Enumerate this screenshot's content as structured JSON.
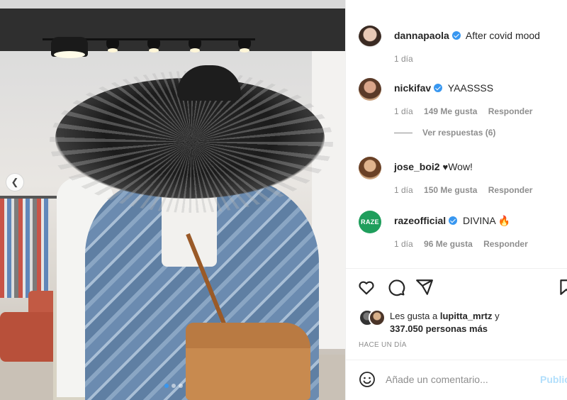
{
  "post": {
    "photo_alt": "",
    "dots": [
      true,
      false,
      false
    ]
  },
  "comments": [
    {
      "username": "dannapaola",
      "verified": true,
      "text": "After covid mood",
      "time": "1 día"
    },
    {
      "username": "nickifav",
      "verified": true,
      "text": "YAASSSS",
      "time": "1 día",
      "likes": "149 Me gusta",
      "reply": "Responder"
    },
    {
      "username": "jose_boi2",
      "verified": false,
      "text": "Wow!",
      "time": "1 día",
      "likes": "150 Me gusta",
      "reply": "Responder"
    },
    {
      "username": "razeofficial",
      "verified": true,
      "text": "DIVINA",
      "time": "1 día",
      "likes": "96 Me gusta",
      "reply": "Responder",
      "avatar_text": "RAZE"
    }
  ],
  "view_replies": "Ver respuestas (6)",
  "likes": {
    "prefix": "Les gusta a ",
    "user": "lupitta_mrtz",
    "suffix": " y",
    "count": "337.050 personas más"
  },
  "time_ago": "HACE UN DÍA",
  "add_comment": {
    "placeholder": "Añade un comentario...",
    "post_label": "Publicar"
  },
  "icons": [
    "like-icon",
    "comment-icon",
    "share-icon",
    "save-icon",
    "emoji-icon",
    "chevron-left-icon"
  ]
}
